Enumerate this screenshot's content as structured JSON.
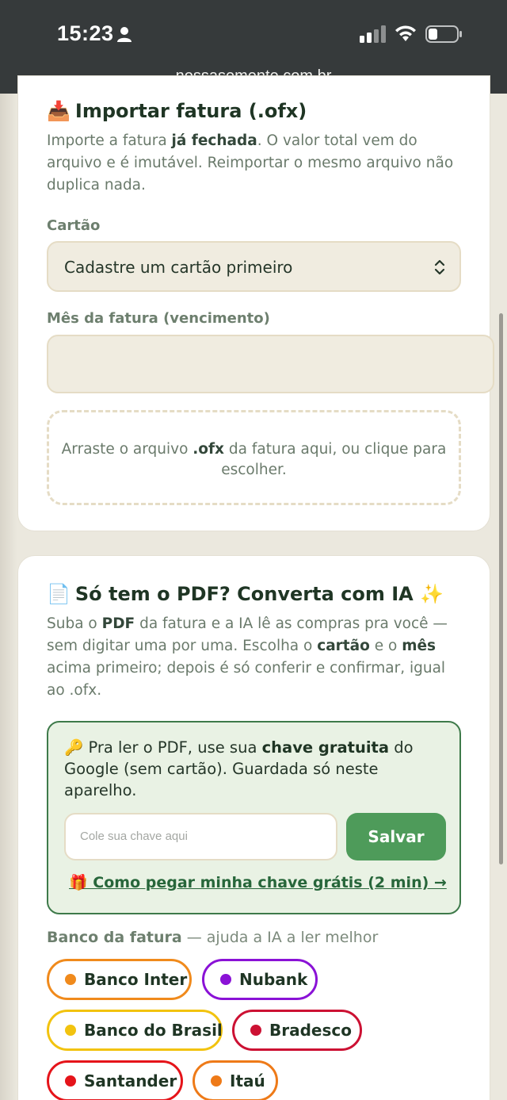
{
  "status_bar": {
    "time": "15:23",
    "url": "nossasemente.com.br"
  },
  "import_card": {
    "title_emoji": "📥",
    "title": "Importar fatura (.ofx)",
    "desc_part1": "Importe a fatura ",
    "desc_bold": "já fechada",
    "desc_part2": ". O valor total vem do arquivo e é imutável. Reimportar o mesmo arquivo não duplica nada.",
    "card_label": "Cartão",
    "card_select_value": "Cadastre um cartão primeiro",
    "month_label": "Mês da fatura (vencimento)",
    "month_value": "",
    "dropzone_part1": "Arraste o arquivo ",
    "dropzone_bold": ".ofx",
    "dropzone_part2": " da fatura aqui, ou clique para escolher."
  },
  "pdf_card": {
    "title_emoji": "📄",
    "title": "Só tem o PDF? Converta com IA ✨",
    "desc_a": "Suba o ",
    "desc_b": "PDF",
    "desc_c": " da fatura e a IA lê as compras pra você — sem digitar uma por uma. Escolha o ",
    "desc_d": "cartão",
    "desc_e": " e o ",
    "desc_f": "mês",
    "desc_g": " acima primeiro; depois é só conferir e confirmar, igual ao .ofx.",
    "key_emoji": "🔑",
    "key_text_a": " Pra ler o PDF, use sua ",
    "key_text_bold": "chave gratuita",
    "key_text_b": " do Google (sem cartão). Guardada só neste aparelho.",
    "key_placeholder": "Cole sua chave aqui",
    "save_label": "Salvar",
    "key_link": "🎁 Como pegar minha chave grátis (2 min) →",
    "bank_label_bold": "Banco da fatura",
    "bank_label_rest": " — ajuda a IA a ler melhor",
    "banks": [
      {
        "label": "Banco Inter",
        "color": "#f08a1c"
      },
      {
        "label": "Nubank",
        "color": "#8a12d6"
      },
      {
        "label": "Banco do Brasil",
        "color": "#f2c30f"
      },
      {
        "label": "Bradesco",
        "color": "#cc1133"
      },
      {
        "label": "Santander",
        "color": "#e5141a"
      },
      {
        "label": "Itaú",
        "color": "#ee7a18"
      }
    ]
  },
  "colors": {
    "accent_green": "#4e9b5a",
    "dark_green": "#1f3524",
    "cream": "#f0ece0"
  }
}
